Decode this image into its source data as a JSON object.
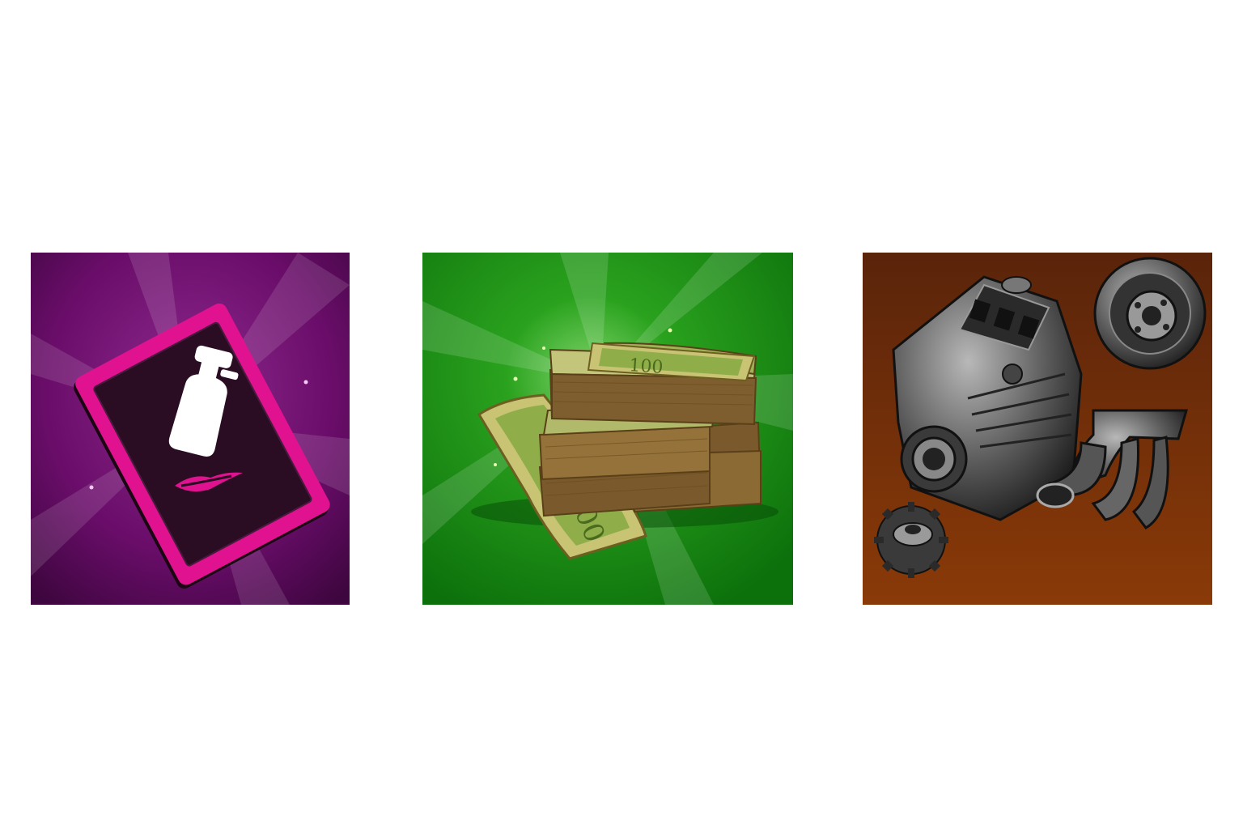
{
  "tiles": [
    {
      "id": "cosmetics",
      "icon": "phone-with-perfume-bottle-icon",
      "background": "#6a0d6a",
      "accent": "#e0128f"
    },
    {
      "id": "cash",
      "icon": "cash-stack-icon",
      "background": "#11800f",
      "accent": "#c9c474",
      "banknote_marks": [
        "100",
        "100"
      ]
    },
    {
      "id": "parts",
      "icon": "engine-parts-icon",
      "background": "#8a3a08",
      "accent": "#555555"
    }
  ]
}
